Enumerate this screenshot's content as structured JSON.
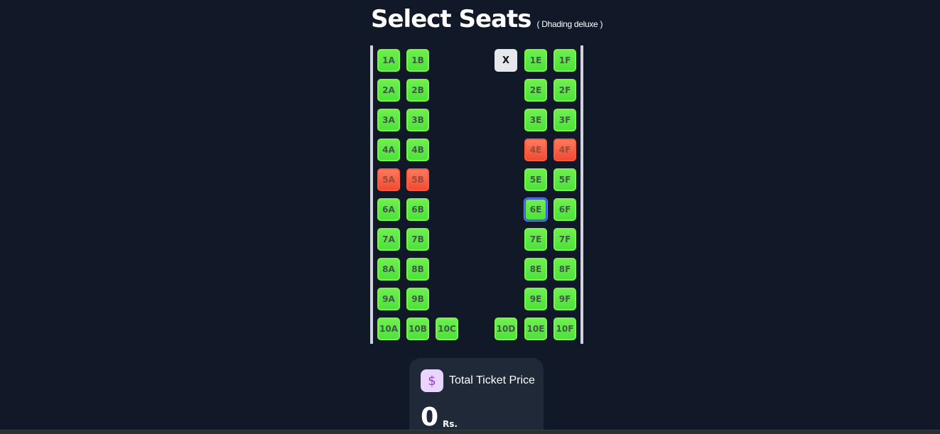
{
  "header": {
    "title": "Select Seats",
    "subtitle": "( Dhading deluxe )"
  },
  "seats": {
    "row1": [
      {
        "label": "1A",
        "status": "available"
      },
      {
        "label": "1B",
        "status": "available"
      },
      {
        "label": "X",
        "status": "driver"
      },
      {
        "label": "1E",
        "status": "available"
      },
      {
        "label": "1F",
        "status": "available"
      }
    ],
    "row2": [
      {
        "label": "2A",
        "status": "available"
      },
      {
        "label": "2B",
        "status": "available"
      },
      {
        "label": "2E",
        "status": "available"
      },
      {
        "label": "2F",
        "status": "available"
      }
    ],
    "row3": [
      {
        "label": "3A",
        "status": "available"
      },
      {
        "label": "3B",
        "status": "available"
      },
      {
        "label": "3E",
        "status": "available"
      },
      {
        "label": "3F",
        "status": "available"
      }
    ],
    "row4": [
      {
        "label": "4A",
        "status": "available"
      },
      {
        "label": "4B",
        "status": "available"
      },
      {
        "label": "4E",
        "status": "booked"
      },
      {
        "label": "4F",
        "status": "booked"
      }
    ],
    "row5": [
      {
        "label": "5A",
        "status": "booked"
      },
      {
        "label": "5B",
        "status": "booked"
      },
      {
        "label": "5E",
        "status": "available"
      },
      {
        "label": "5F",
        "status": "available"
      }
    ],
    "row6": [
      {
        "label": "6A",
        "status": "available"
      },
      {
        "label": "6B",
        "status": "available"
      },
      {
        "label": "6E",
        "status": "focused"
      },
      {
        "label": "6F",
        "status": "available"
      }
    ],
    "row7": [
      {
        "label": "7A",
        "status": "available"
      },
      {
        "label": "7B",
        "status": "available"
      },
      {
        "label": "7E",
        "status": "available"
      },
      {
        "label": "7F",
        "status": "available"
      }
    ],
    "row8": [
      {
        "label": "8A",
        "status": "available"
      },
      {
        "label": "8B",
        "status": "available"
      },
      {
        "label": "8E",
        "status": "available"
      },
      {
        "label": "8F",
        "status": "available"
      }
    ],
    "row9": [
      {
        "label": "9A",
        "status": "available"
      },
      {
        "label": "9B",
        "status": "available"
      },
      {
        "label": "9E",
        "status": "available"
      },
      {
        "label": "9F",
        "status": "available"
      }
    ],
    "row10": [
      {
        "label": "10A",
        "status": "available"
      },
      {
        "label": "10B",
        "status": "available"
      },
      {
        "label": "10C",
        "status": "available"
      },
      {
        "label": "10D",
        "status": "available"
      },
      {
        "label": "10E",
        "status": "available"
      },
      {
        "label": "10F",
        "status": "available"
      }
    ]
  },
  "price": {
    "icon": "dollar-icon",
    "icon_glyph": "$",
    "label": "Total Ticket Price",
    "value": "0",
    "currency": "Rs."
  },
  "colors": {
    "background": "#111827",
    "seat_available": "#4ee23a",
    "seat_booked": "#f04a32",
    "seat_driver": "#e5e7eb",
    "card": "#1f2937",
    "icon_badge": "#ead5ff",
    "icon_accent": "#9b3bd8"
  }
}
